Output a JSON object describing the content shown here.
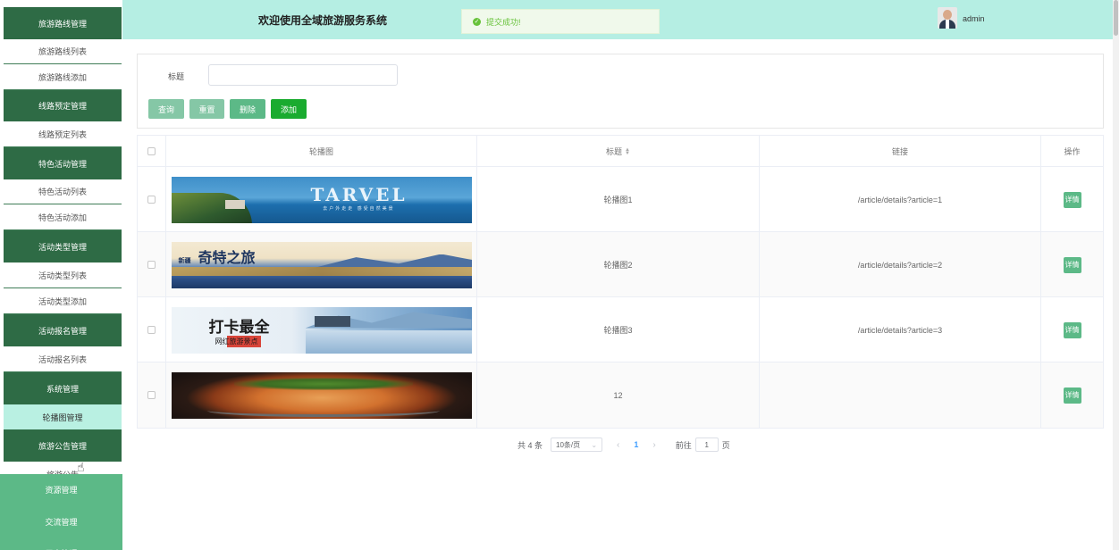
{
  "header": {
    "title": "欢迎使用全域旅游服务系统",
    "toast": "提交成功!",
    "user": "admin"
  },
  "sidebar": {
    "items": [
      {
        "label": "旅游路线管理",
        "kind": "group"
      },
      {
        "label": "旅游路线列表",
        "kind": "sub"
      },
      {
        "label": "旅游路线添加",
        "kind": "sub"
      },
      {
        "label": "线路预定管理",
        "kind": "group"
      },
      {
        "label": "线路预定列表",
        "kind": "sub"
      },
      {
        "label": "特色活动管理",
        "kind": "group"
      },
      {
        "label": "特色活动列表",
        "kind": "sub"
      },
      {
        "label": "特色活动添加",
        "kind": "sub"
      },
      {
        "label": "活动类型管理",
        "kind": "group"
      },
      {
        "label": "活动类型列表",
        "kind": "sub"
      },
      {
        "label": "活动类型添加",
        "kind": "sub"
      },
      {
        "label": "活动报名管理",
        "kind": "group"
      },
      {
        "label": "活动报名列表",
        "kind": "sub"
      },
      {
        "label": "系统管理",
        "kind": "group"
      },
      {
        "label": "轮播图管理",
        "kind": "active"
      },
      {
        "label": "旅游公告管理",
        "kind": "group"
      },
      {
        "label": "旅游公告",
        "kind": "sub"
      }
    ],
    "bottom": [
      "资源管理",
      "交流管理",
      "用户管理"
    ]
  },
  "search": {
    "label": "标题",
    "value": "",
    "placeholder": "",
    "buttons": {
      "query": "查询",
      "reset": "重置",
      "delete": "删除",
      "add": "添加"
    }
  },
  "table": {
    "columns": {
      "image": "轮播图",
      "title": "标题",
      "link": "链接",
      "action": "操作"
    },
    "rows": [
      {
        "title": "轮播图1",
        "link": "/article/details?article=1",
        "action": "详情",
        "banner_text": "TARVEL",
        "banner_sub": "去户外走走 感受自然美景"
      },
      {
        "title": "轮播图2",
        "link": "/article/details?article=2",
        "action": "详情",
        "banner_text": "奇特之旅",
        "banner_sub": "新疆"
      },
      {
        "title": "轮播图3",
        "link": "/article/details?article=3",
        "action": "详情",
        "banner_text": "打卡最全",
        "banner_sub": "网红旅游景点"
      },
      {
        "title": "12",
        "link": "",
        "action": "详情",
        "banner_text": "",
        "banner_sub": ""
      }
    ]
  },
  "pagination": {
    "total": "共 4 条",
    "page_size": "10条/页",
    "current": "1",
    "goto_label": "前往",
    "goto_value": "1",
    "page_unit": "页"
  },
  "colors": {
    "header_bg": "#b5eee3",
    "sidebar_group": "#2e6b45",
    "sidebar_active": "#b9f0e2",
    "sidebar_bottom": "#5cb987",
    "primary_button": "#5cb987",
    "add_button": "#1aab2f"
  },
  "icons": {
    "toast": "check-circle-icon",
    "sort": "sort-caret-icon",
    "cursor": "hand-pointer-icon"
  }
}
